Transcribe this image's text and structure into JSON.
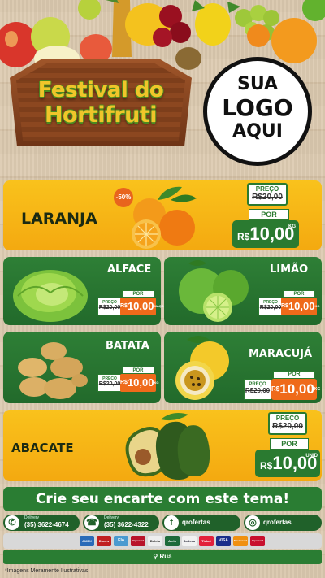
{
  "header": {
    "title_line1": "Festival do",
    "title_line2": "Hortifruti",
    "logo_placeholder": [
      "SUA",
      "LOGO",
      "AQUI"
    ]
  },
  "products": {
    "laranja": {
      "name": "LARANJA",
      "badge": "-50%",
      "preco_label": "PREÇO",
      "old_price": "R$20,00",
      "por_label": "POR",
      "currency": "R$",
      "new_price": "10,00",
      "unit": "KG"
    },
    "alface": {
      "name": "ALFACE",
      "preco_label": "PREÇO",
      "old_price": "R$20,00",
      "por_label": "POR",
      "currency": "R$",
      "new_price": "10,00",
      "unit": "MAÇO"
    },
    "limao": {
      "name": "LIMÃO",
      "preco_label": "PREÇO",
      "old_price": "R$20,00",
      "por_label": "POR",
      "currency": "R$",
      "new_price": "10,00",
      "unit": "KG"
    },
    "batata": {
      "name": "BATATA",
      "preco_label": "PREÇO",
      "old_price": "R$20,00",
      "por_label": "POR",
      "currency": "R$",
      "new_price": "10,00",
      "unit": "KG"
    },
    "maracuja": {
      "name": "MARACUJÁ",
      "preco_label": "PREÇO",
      "old_price": "R$20,00",
      "por_label": "POR",
      "currency": "R$",
      "new_price": "10,00",
      "unit": "KG"
    },
    "abacate": {
      "name": "ABACATE",
      "preco_label": "PREÇO",
      "old_price": "R$20,00",
      "por_label": "POR",
      "currency": "R$",
      "new_price": "10,00",
      "unit": "UNID"
    }
  },
  "cta": "Crie seu encarte com este tema!",
  "contacts": [
    {
      "label": "Delivery",
      "value": "(35) 3622-4674",
      "icon": "whatsapp-icon"
    },
    {
      "label": "Delivery",
      "value": "(35) 3622-4322",
      "icon": "phone-icon"
    },
    {
      "value": "qrofertas",
      "icon": "facebook-icon"
    },
    {
      "value": "qrofertas",
      "icon": "instagram-icon"
    }
  ],
  "payments": [
    "AMEX",
    "Diners",
    "Elo",
    "Hipercard",
    "Boleto",
    "Alelo",
    "Sodexo",
    "Ticket",
    "VISA",
    "Mastercard",
    "Hipercard"
  ],
  "address": "Rua",
  "disclaimer": "*Imagens Meramente Ilustrativas",
  "colors": {
    "green": "#2a7d33",
    "orange_card": "#f6b816",
    "price_orange": "#ef6a1a"
  }
}
